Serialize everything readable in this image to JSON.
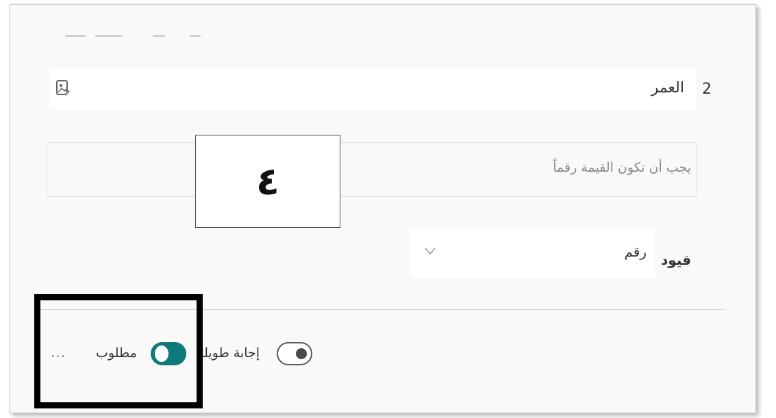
{
  "question": {
    "number": "2",
    "title": "العمر",
    "hint": "يجب أن تكون القيمة رقماً",
    "image_icon": "image-icon"
  },
  "callout": {
    "text": "٤"
  },
  "restrictions": {
    "label": "قيود",
    "selected": "رقم",
    "chevron_icon": "chevron-down-icon"
  },
  "footer": {
    "long_answer_label": "إجابة طويلة",
    "long_answer_on": false,
    "required_label": "مطلوب",
    "required_on": true,
    "more_icon": "ellipsis-icon",
    "more_text": "..."
  },
  "colors": {
    "accent": "#0f7a7a",
    "highlight": "#000000"
  }
}
